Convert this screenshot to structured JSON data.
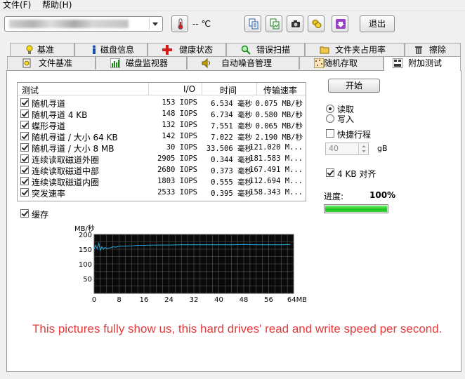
{
  "menu": {
    "file": "文件(F)",
    "help": "帮助(H)"
  },
  "toolbar": {
    "temperature": "-- ℃",
    "exit_label": "退出",
    "icons": [
      "thermometer-icon",
      "copy-text-icon",
      "copy-image-icon",
      "camera-icon",
      "coins-icon",
      "download-icon"
    ]
  },
  "tabs_row1": [
    "基准",
    "磁盘信息",
    "健康状态",
    "错误扫描",
    "文件夹占用率",
    "擦除"
  ],
  "tabs_row2": [
    "文件基准",
    "磁盘监视器",
    "自动噪音管理",
    "随机存取",
    "附加测试"
  ],
  "active_tab": "附加测试",
  "table": {
    "headers": {
      "test": "测试",
      "io": "I/O",
      "time": "时间",
      "speed": "传输速率"
    },
    "rows": [
      {
        "name": "随机寻道",
        "io": "153 IOPS",
        "time": "6.534 毫秒",
        "speed": "0.075 MB/秒"
      },
      {
        "name": "随机寻道 4 KB",
        "io": "148 IOPS",
        "time": "6.734 毫秒",
        "speed": "0.580 MB/秒"
      },
      {
        "name": "蝶形寻道",
        "io": "132 IOPS",
        "time": "7.551 毫秒",
        "speed": "0.065 MB/秒"
      },
      {
        "name": "随机寻道 / 大小 64 KB",
        "io": "142 IOPS",
        "time": "7.022 毫秒",
        "speed": "2.190 MB/秒"
      },
      {
        "name": "随机寻道 / 大小 8 MB",
        "io": "30 IOPS",
        "time": "33.506 毫秒",
        "speed": "121.020 M..."
      },
      {
        "name": "连续读取磁道外圈",
        "io": "2905 IOPS",
        "time": "0.344 毫秒",
        "speed": "181.583 M..."
      },
      {
        "name": "连续读取磁道中部",
        "io": "2680 IOPS",
        "time": "0.373 毫秒",
        "speed": "167.491 M..."
      },
      {
        "name": "连续读取磁道内圈",
        "io": "1803 IOPS",
        "time": "0.555 毫秒",
        "speed": "112.694 M..."
      },
      {
        "name": "突发速率",
        "io": "2533 IOPS",
        "time": "0.395 毫秒",
        "speed": "158.343 M..."
      }
    ]
  },
  "cache_label": "缓存",
  "side": {
    "start_label": "开始",
    "read_label": "读取",
    "write_label": "写入",
    "short_stroke_label": "快捷行程",
    "short_stroke_value": "40",
    "short_stroke_unit": "gB",
    "align_label": "4 KB 对齐",
    "progress_label": "进度:",
    "progress_value": "100%",
    "progress_fraction": 1.0
  },
  "chart_data": {
    "type": "line",
    "ylabel": "MB/秒",
    "y_ticks": [
      "200",
      "150",
      "100",
      "50"
    ],
    "x_ticks": [
      "0",
      "8",
      "16",
      "24",
      "32",
      "40",
      "48",
      "56",
      "64MB"
    ],
    "xlim": [
      0,
      64
    ],
    "ylim": [
      0,
      200
    ],
    "grid": true,
    "series": [
      {
        "color": "#2aa9e0",
        "x": [
          0,
          0.5,
          1,
          1.5,
          2,
          2.5,
          3,
          3.5,
          4,
          5,
          6,
          7,
          8,
          10,
          12,
          14,
          16,
          20,
          24,
          28,
          32,
          36,
          40,
          44,
          48,
          52,
          56,
          60,
          63
        ],
        "y": [
          150,
          163,
          152,
          170,
          146,
          158,
          150,
          156,
          152,
          154,
          158,
          157,
          160,
          160,
          161,
          163,
          163,
          164,
          164,
          165,
          165,
          165,
          165,
          165,
          166,
          165,
          165,
          165,
          166
        ]
      }
    ]
  },
  "caption": "This pictures fully show us, this hard drives' read and write speed per second."
}
